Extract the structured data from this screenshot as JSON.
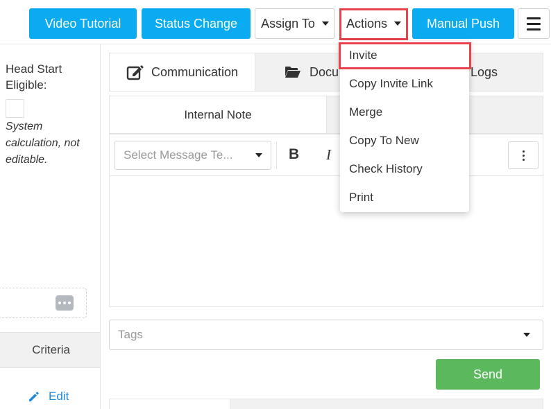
{
  "toolbar": {
    "video_tutorial": "Video Tutorial",
    "status_change": "Status Change",
    "assign_to": "Assign To",
    "actions": "Actions",
    "manual_push": "Manual Push",
    "menu_icon": "hamburger-icon"
  },
  "colors": {
    "primary": "#0aabf0",
    "success": "#5cb85c",
    "highlight": "#e8424a",
    "link": "#1f87d8"
  },
  "actions_menu": {
    "items": [
      "Invite",
      "Copy Invite Link",
      "Merge",
      "Copy To New",
      "Check History",
      "Print"
    ],
    "highlighted": "Invite"
  },
  "left_panel": {
    "field_label": "Head Start Eligible:",
    "note": "System calculation, not editable.",
    "criteria_label": "Criteria",
    "edit_label": "Edit"
  },
  "tabs": {
    "communication": "Communication",
    "documents": "Docu",
    "logs": "Logs"
  },
  "subtabs": {
    "internal_note": "Internal Note"
  },
  "editor": {
    "template_placeholder": "Select Message Te...",
    "bold": "B",
    "italic": "I"
  },
  "tags": {
    "placeholder": "Tags"
  },
  "send_label": "Send"
}
